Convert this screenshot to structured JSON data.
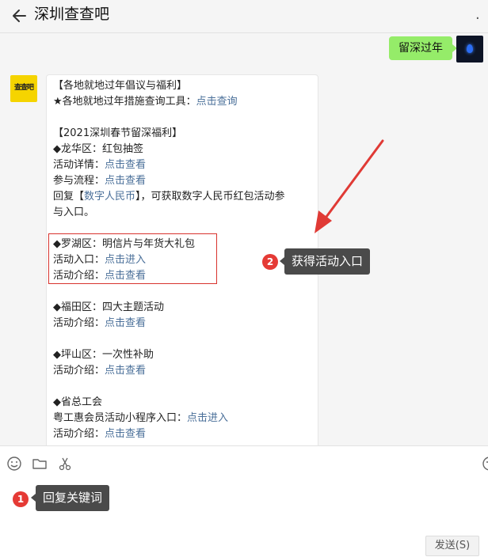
{
  "header": {
    "title": "深圳查查吧",
    "more": "."
  },
  "my_message": {
    "text": "留深过年"
  },
  "bot": {
    "avatar_text": "查查吧"
  },
  "message_lines": [
    [
      {
        "t": "【各地就地过年倡议与福利】"
      }
    ],
    [
      {
        "t": "★各地就地过年措施查询工具："
      },
      {
        "t": "点击查询",
        "link": true
      }
    ],
    [],
    [
      {
        "t": "【2021深圳春节留深福利】"
      }
    ],
    [
      {
        "t": "◆龙华区：红包抽签"
      }
    ],
    [
      {
        "t": "活动详情："
      },
      {
        "t": "点击查看",
        "link": true
      }
    ],
    [
      {
        "t": "参与流程："
      },
      {
        "t": "点击查看",
        "link": true
      }
    ],
    [
      {
        "t": "回复【"
      },
      {
        "t": "数字人民币",
        "link": true
      },
      {
        "t": "】，可获取数字人民币红包活动参"
      }
    ],
    [
      {
        "t": "与入口。"
      }
    ],
    [],
    [
      {
        "t": "◆罗湖区：明信片与年货大礼包"
      }
    ],
    [
      {
        "t": "活动入口："
      },
      {
        "t": "点击进入",
        "link": true
      }
    ],
    [
      {
        "t": "活动介绍："
      },
      {
        "t": "点击查看",
        "link": true
      }
    ],
    [],
    [
      {
        "t": "◆福田区：四大主题活动"
      }
    ],
    [
      {
        "t": "活动介绍："
      },
      {
        "t": "点击查看",
        "link": true
      }
    ],
    [],
    [
      {
        "t": "◆坪山区：一次性补助"
      }
    ],
    [
      {
        "t": "活动介绍："
      },
      {
        "t": "点击查看",
        "link": true
      }
    ],
    [],
    [
      {
        "t": "◆省总工会"
      }
    ],
    [
      {
        "t": "粤工惠会员活动小程序入口："
      },
      {
        "t": "点击进入",
        "link": true
      }
    ],
    [
      {
        "t": "活动介绍："
      },
      {
        "t": "点击查看",
        "link": true
      }
    ]
  ],
  "annotations": {
    "step1_number": "1",
    "step1_label": "回复关键词",
    "step2_number": "2",
    "step2_label": "获得活动入口",
    "color": "#e53a35"
  },
  "toolbar": {
    "icons": [
      "emoji-icon",
      "folder-icon",
      "scissors-icon",
      "emoji-icon"
    ]
  },
  "send_button": {
    "label": "发送(S)"
  },
  "colors": {
    "link": "#4a6f99",
    "my_bubble": "#95ec69",
    "highlight": "#d8332e"
  }
}
